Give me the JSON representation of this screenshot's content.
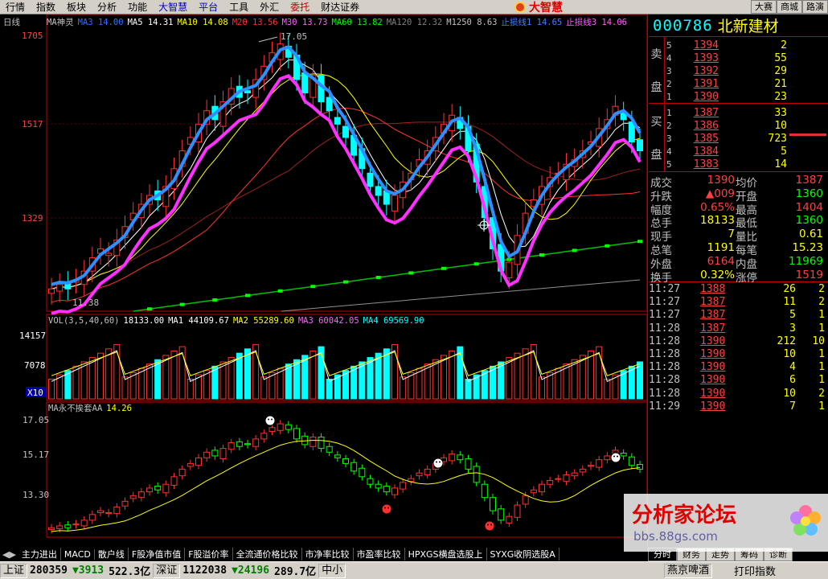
{
  "menu": [
    "行情",
    "指数",
    "板块",
    "分析",
    "功能",
    "大智慧",
    "平台",
    "工具",
    "外汇",
    "委托",
    "财达证券"
  ],
  "brand": "大智慧",
  "right_buttons": [
    "大赛",
    "商城",
    "路演"
  ],
  "chart": {
    "period_label": "日线",
    "price_axis": [
      "1705",
      "1517",
      "1329"
    ],
    "ma_header": [
      {
        "t": "MA神灵",
        "c": "#c0c0c0"
      },
      {
        "t": "MA3 14.00",
        "c": "#3070ff"
      },
      {
        "t": "MA5 14.31",
        "c": "#ffffff"
      },
      {
        "t": "MA10 14.08",
        "c": "#ffff00"
      },
      {
        "t": "M20 13.56",
        "c": "#ff3030"
      },
      {
        "t": "M30 13.73",
        "c": "#ff60ff"
      },
      {
        "t": "MA60 13.82",
        "c": "#00ff00"
      },
      {
        "t": "MA120 12.32",
        "c": "#808080"
      },
      {
        "t": "M1250 8.63",
        "c": "#c0c0c0"
      },
      {
        "t": "止损线1 14.65",
        "c": "#4080ff"
      },
      {
        "t": "止损线3 14.06",
        "c": "#ff60ff"
      }
    ],
    "high_label": "17.05",
    "low_label": "11.38",
    "vol_header": [
      {
        "t": "VOL(3,5,40,60)",
        "c": "#c0c0c0"
      },
      {
        "t": "18133.00",
        "c": "#ffffff"
      },
      {
        "t": "MA1 44109.67",
        "c": "#ffffff"
      },
      {
        "t": "MA2 55289.60",
        "c": "#ffff00"
      },
      {
        "t": "MA3 60042.05",
        "c": "#ff60ff"
      },
      {
        "t": "MA4 69569.90",
        "c": "#00ffff"
      }
    ],
    "vol_axis": [
      "14157",
      "7078",
      "X10"
    ],
    "ind_header": [
      {
        "t": "MA永不挨套AA",
        "c": "#c0c0c0"
      },
      {
        "t": "14.26",
        "c": "#ffff00"
      }
    ],
    "ind_axis": [
      "17.05",
      "15.17",
      "13.30"
    ]
  },
  "stock": {
    "code": "000786",
    "name": "北新建材"
  },
  "orderbook": {
    "sell_label": [
      "卖",
      "盘"
    ],
    "buy_label": [
      "买",
      "盘"
    ],
    "sell": [
      {
        "lv": "5",
        "px": "1394",
        "qty": "2"
      },
      {
        "lv": "4",
        "px": "1393",
        "qty": "55"
      },
      {
        "lv": "3",
        "px": "1392",
        "qty": "29"
      },
      {
        "lv": "2",
        "px": "1391",
        "qty": "21"
      },
      {
        "lv": "1",
        "px": "1390",
        "qty": "23"
      }
    ],
    "buy": [
      {
        "lv": "1",
        "px": "1387",
        "qty": "33"
      },
      {
        "lv": "2",
        "px": "1386",
        "qty": "10"
      },
      {
        "lv": "3",
        "px": "1385",
        "qty": "723"
      },
      {
        "lv": "4",
        "px": "1384",
        "qty": "5"
      },
      {
        "lv": "5",
        "px": "1383",
        "qty": "14"
      }
    ]
  },
  "stats": [
    {
      "l1": "成交",
      "v1": "1390",
      "c1": "#ff4040",
      "l2": "均价",
      "v2": "1387",
      "c2": "#ff4040"
    },
    {
      "l1": "升跌",
      "v1": "▲009",
      "c1": "#ff4040",
      "l2": "开盘",
      "v2": "1360",
      "c2": "#00ff00"
    },
    {
      "l1": "幅度",
      "v1": "0.65%",
      "c1": "#ff4040",
      "l2": "最高",
      "v2": "1404",
      "c2": "#ff4040"
    },
    {
      "l1": "总手",
      "v1": "18133",
      "c1": "#ffff00",
      "l2": "最低",
      "v2": "1360",
      "c2": "#00ff00"
    },
    {
      "l1": "现手",
      "v1": "7",
      "c1": "#ffff00",
      "l2": "量比",
      "v2": "0.61",
      "c2": "#ffff00"
    },
    {
      "l1": "总笔",
      "v1": "1191",
      "c1": "#ffff00",
      "l2": "每笔",
      "v2": "15.23",
      "c2": "#ffff00"
    },
    {
      "l1": "外盘",
      "v1": "6164",
      "c1": "#ff4040",
      "l2": "内盘",
      "v2": "11969",
      "c2": "#00ff00"
    },
    {
      "l1": "换手",
      "v1": "0.32%",
      "c1": "#ffff00",
      "l2": "涨停",
      "v2": "1519",
      "c2": "#ff4040"
    }
  ],
  "ticks": [
    {
      "t": "11:27",
      "p": "1388",
      "v": "26",
      "n": "2"
    },
    {
      "t": "11:27",
      "p": "1387",
      "v": "11",
      "n": "2"
    },
    {
      "t": "11:27",
      "p": "1387",
      "v": "5",
      "n": "1"
    },
    {
      "t": "11:28",
      "p": "1387",
      "v": "3",
      "n": "1"
    },
    {
      "t": "11:28",
      "p": "1390",
      "v": "212",
      "n": "10"
    },
    {
      "t": "11:28",
      "p": "1390",
      "v": "10",
      "n": "1"
    },
    {
      "t": "11:28",
      "p": "1390",
      "v": "4",
      "n": "1"
    },
    {
      "t": "11:28",
      "p": "1390",
      "v": "6",
      "n": "1"
    },
    {
      "t": "11:28",
      "p": "1390",
      "v": "10",
      "n": "2"
    },
    {
      "t": "11:29",
      "p": "1390",
      "v": "7",
      "n": "1"
    }
  ],
  "tabs": [
    "主力进出",
    "MACD",
    "散户线",
    "F股净值市值",
    "F股溢价率",
    "全流通价格比较",
    "市净率比较",
    "市盈率比较",
    "HPXGS横盘选股上",
    "SYXG收阴选股A"
  ],
  "right_tabs": [
    "分时",
    "财务",
    "走势",
    "筹码",
    "诊断"
  ],
  "watermark": {
    "title": "分析家论坛",
    "url": "bbs.88gs.com"
  },
  "status": {
    "m1": "上证",
    "v1": "280359",
    "c1": "▼3913",
    "p1": "522.3亿",
    "m2": "深证",
    "v2": "1122038",
    "c2": "▼24196",
    "p2": "289.7亿",
    "m3": "中小",
    "idx": "燕京啤酒",
    "idx2": "打印指数"
  }
}
